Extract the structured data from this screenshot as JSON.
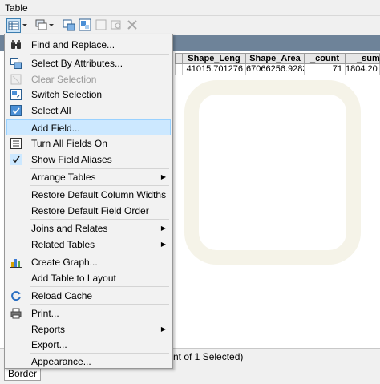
{
  "window": {
    "title": "Table"
  },
  "colors": {
    "accent": "#cce8ff",
    "header_bg": "#6e8399"
  },
  "toolbar": {
    "icons": [
      "table-options-icon",
      "dropdown-arrow-icon",
      "related-tables-icon",
      "select-by-attributes-icon",
      "switch-selection-icon",
      "clear-selection-icon",
      "zoom-to-selected-icon",
      "delete-selected-icon"
    ]
  },
  "table": {
    "columns": [
      "Shape_Leng",
      "Shape_Area",
      "_count",
      "_sum"
    ],
    "rows": [
      [
        "41015.701276",
        "67066256.9283",
        "71",
        "1804.20"
      ]
    ]
  },
  "status": {
    "text": "nt of 1 Selected)"
  },
  "tabs": {
    "active": "Border"
  },
  "menu": {
    "items": [
      {
        "label": "Find and Replace...",
        "icon": "binoculars-icon"
      },
      {
        "label": "Select By Attributes...",
        "icon": "select-by-attributes-icon"
      },
      {
        "label": "Clear Selection",
        "icon": "clear-selection-icon",
        "disabled": true
      },
      {
        "label": "Switch Selection",
        "icon": "switch-selection-icon"
      },
      {
        "label": "Select All",
        "icon": "select-all-icon"
      },
      {
        "label": "Add Field...",
        "highlighted": true
      },
      {
        "label": "Turn All Fields On",
        "icon": "fields-list-icon"
      },
      {
        "label": "Show Field Aliases",
        "icon": "checkmark-icon",
        "checked": true
      },
      {
        "label": "Arrange Tables",
        "submenu": true
      },
      {
        "label": "Restore Default Column Widths"
      },
      {
        "label": "Restore Default Field Order"
      },
      {
        "label": "Joins and Relates",
        "submenu": true
      },
      {
        "label": "Related Tables",
        "submenu": true
      },
      {
        "label": "Create Graph...",
        "icon": "bar-graph-icon"
      },
      {
        "label": "Add Table to Layout"
      },
      {
        "label": "Reload Cache",
        "icon": "reload-icon"
      },
      {
        "label": "Print...",
        "icon": "printer-icon"
      },
      {
        "label": "Reports",
        "submenu": true
      },
      {
        "label": "Export..."
      },
      {
        "label": "Appearance..."
      }
    ]
  }
}
